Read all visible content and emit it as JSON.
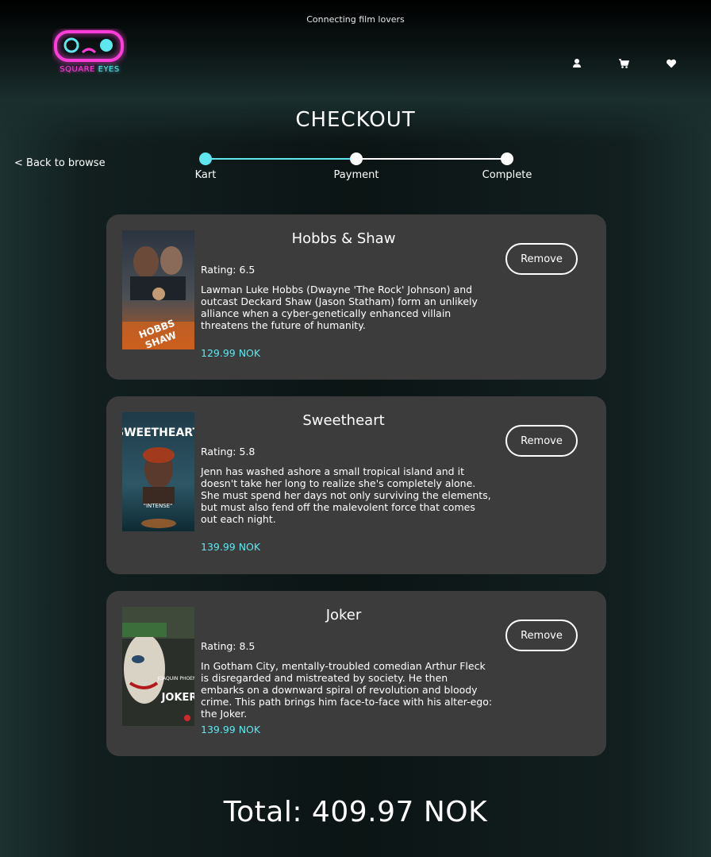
{
  "header": {
    "tagline": "Connecting film lovers",
    "logo_text_1": "SQUARE",
    "logo_text_2": "EYES",
    "icons": [
      "user-icon",
      "cart-icon",
      "heart-icon"
    ]
  },
  "page_title": "CHECKOUT",
  "back_link": "< Back to browse",
  "progress": {
    "steps": [
      {
        "label": "Kart",
        "active": true
      },
      {
        "label": "Payment",
        "active": false
      },
      {
        "label": "Complete",
        "active": false
      }
    ]
  },
  "cart": {
    "items": [
      {
        "title": "Hobbs & Shaw",
        "rating": "Rating: 6.5",
        "description": "Lawman Luke Hobbs (Dwayne 'The Rock' Johnson) and outcast Deckard Shaw (Jason Statham) form an unlikely alliance when a cyber-genetically enhanced villain threatens the future of humanity.",
        "price": "129.99 NOK",
        "remove_label": "Remove"
      },
      {
        "title": "Sweetheart",
        "rating": "Rating: 5.8",
        "description": "Jenn has washed ashore a small tropical island and it doesn't take her long to realize she's completely alone. She must spend her days not only surviving the elements, but must also fend off the malevolent force that comes out each night.",
        "price": "139.99 NOK",
        "remove_label": "Remove"
      },
      {
        "title": "Joker",
        "rating": "Rating: 8.5",
        "description": "In Gotham City, mentally-troubled comedian Arthur Fleck is disregarded and mistreated by society. He then embarks on a downward spiral of revolution and bloody crime. This path brings him face-to-face with his alter-ego: the Joker.",
        "price": "139.99 NOK",
        "remove_label": "Remove"
      }
    ]
  },
  "total": "Total: 409.97 NOK",
  "colors": {
    "accent": "#5fe7f0",
    "logo_pink": "#ff3dd9",
    "card_bg": "#3c3c3c"
  }
}
